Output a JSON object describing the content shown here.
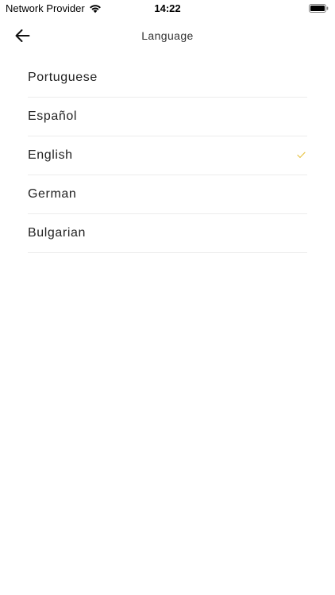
{
  "status_bar": {
    "carrier": "Network Provider",
    "time": "14:22",
    "wifi_icon": "wifi-icon",
    "battery_icon": "battery-icon"
  },
  "nav": {
    "back_icon": "arrow-left-icon",
    "title": "Language"
  },
  "languages": [
    {
      "label": "Portuguese",
      "selected": false
    },
    {
      "label": "Español",
      "selected": false
    },
    {
      "label": "English",
      "selected": true
    },
    {
      "label": "German",
      "selected": false
    },
    {
      "label": "Bulgarian",
      "selected": false
    }
  ],
  "colors": {
    "accent_check": "#e8c54a",
    "divider": "#ececec",
    "background": "#ffffff"
  }
}
